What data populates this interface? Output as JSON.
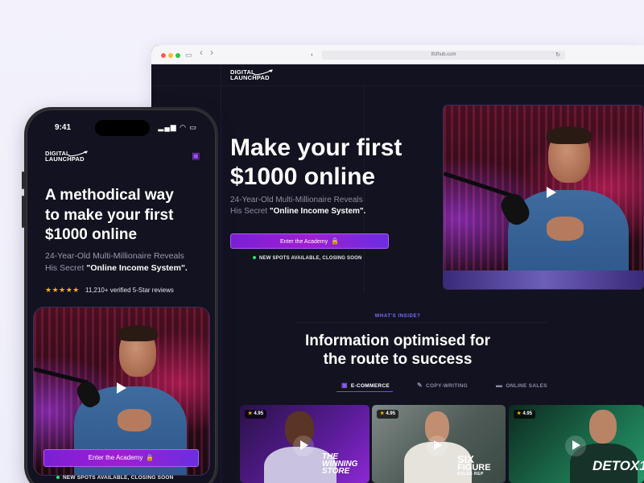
{
  "browser": {
    "url": "tfsfhub.com",
    "controls": {
      "sidebar": "▭",
      "back": "‹",
      "forward": "›",
      "shield": "◐",
      "reload": "↻"
    }
  },
  "brand": {
    "line1": "DIGITAL",
    "line2": "LAUNCHPAD"
  },
  "desktop": {
    "hero_title_1": "Make your first",
    "hero_title_2": "$1000 online",
    "hero_sub_1": "24-Year-Old Multi-Millionaire Reveals",
    "hero_sub_2": "His Secret ",
    "hero_sub_quote": "\"Online Income System\".",
    "cta_label": "Enter the Academy",
    "spots": "NEW SPOTS AVAILABLE, CLOSING SOON",
    "inside_tag": "WHAT'S INSIDE?",
    "section_title_1": "Information optimised for",
    "section_title_2": "the route to success",
    "tabs": [
      {
        "label": "E-COMMERCE",
        "icon": "bag-icon"
      },
      {
        "label": "COPY-WRITING",
        "icon": "pen-icon"
      },
      {
        "label": "ONLINE SALES",
        "icon": "card-icon"
      }
    ],
    "courses": [
      {
        "rating": "4.95",
        "brand_1": "THE",
        "brand_2": "WINNING",
        "brand_3": "STORE"
      },
      {
        "rating": "4.95",
        "brand_1": "SIX",
        "brand_2": "FIGURE",
        "brand_3": "SALES REP"
      },
      {
        "rating": "4.95",
        "brand_1": "DETOX",
        "brand_2": "1",
        "brand_3": ""
      }
    ]
  },
  "phone": {
    "time": "9:41",
    "signal": "▂▄▆ ◠ ▭",
    "title_1": "A methodical way",
    "title_2": "to make your first",
    "title_3": "$1000 online",
    "sub_1": "24-Year-Old Multi-Millionaire Reveals",
    "sub_2": "His Secret ",
    "sub_quote": "\"Online Income System\".",
    "stars": "★★★★★",
    "reviews": "11,210+ verified 5-Star reviews",
    "cta_label": "Enter the Academy",
    "spots": "NEW SPOTS AVAILABLE, CLOSING SOON"
  },
  "colors": {
    "accent": "#8a2be2",
    "spots_dot": "#2fe27b",
    "star": "#f5b301"
  }
}
